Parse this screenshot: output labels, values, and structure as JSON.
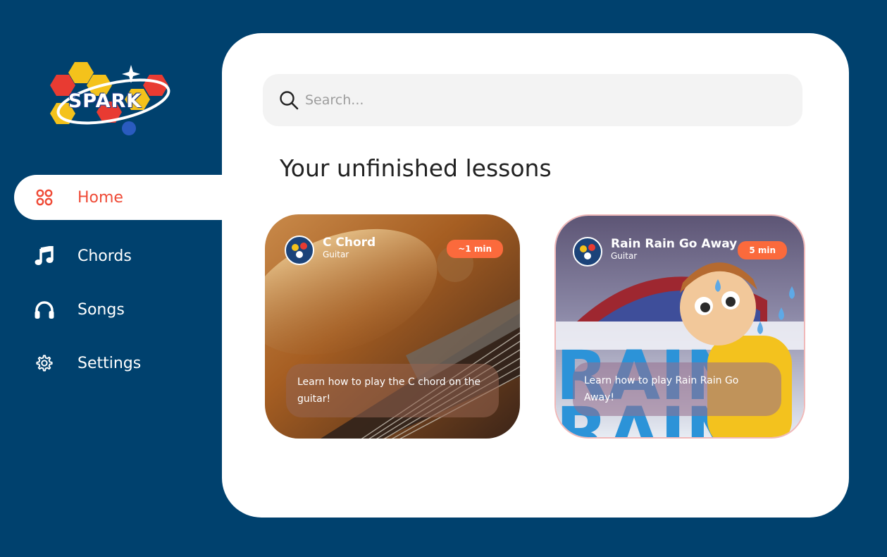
{
  "brand": {
    "logo_text": "SPARK"
  },
  "sidebar": {
    "items": [
      {
        "label": "Home",
        "icon": "grid-icon",
        "active": true
      },
      {
        "label": "Chords",
        "icon": "music-note-icon",
        "active": false
      },
      {
        "label": "Songs",
        "icon": "headphones-icon",
        "active": false
      },
      {
        "label": "Settings",
        "icon": "gear-icon",
        "active": false
      }
    ]
  },
  "search": {
    "placeholder": "Search..."
  },
  "main": {
    "section_title": "Your unfinished lessons",
    "lessons": [
      {
        "title": "C Chord",
        "instrument": "Guitar",
        "duration": "~1 min",
        "description": "Learn how to play the C chord on the guitar!"
      },
      {
        "title": "Rain Rain Go Away",
        "instrument": "Guitar",
        "duration": "5 min",
        "description": "Learn how to play Rain Rain Go Away!"
      }
    ]
  },
  "colors": {
    "background": "#00416e",
    "accent": "#ef4a36",
    "badge": "#fb6a3c"
  }
}
